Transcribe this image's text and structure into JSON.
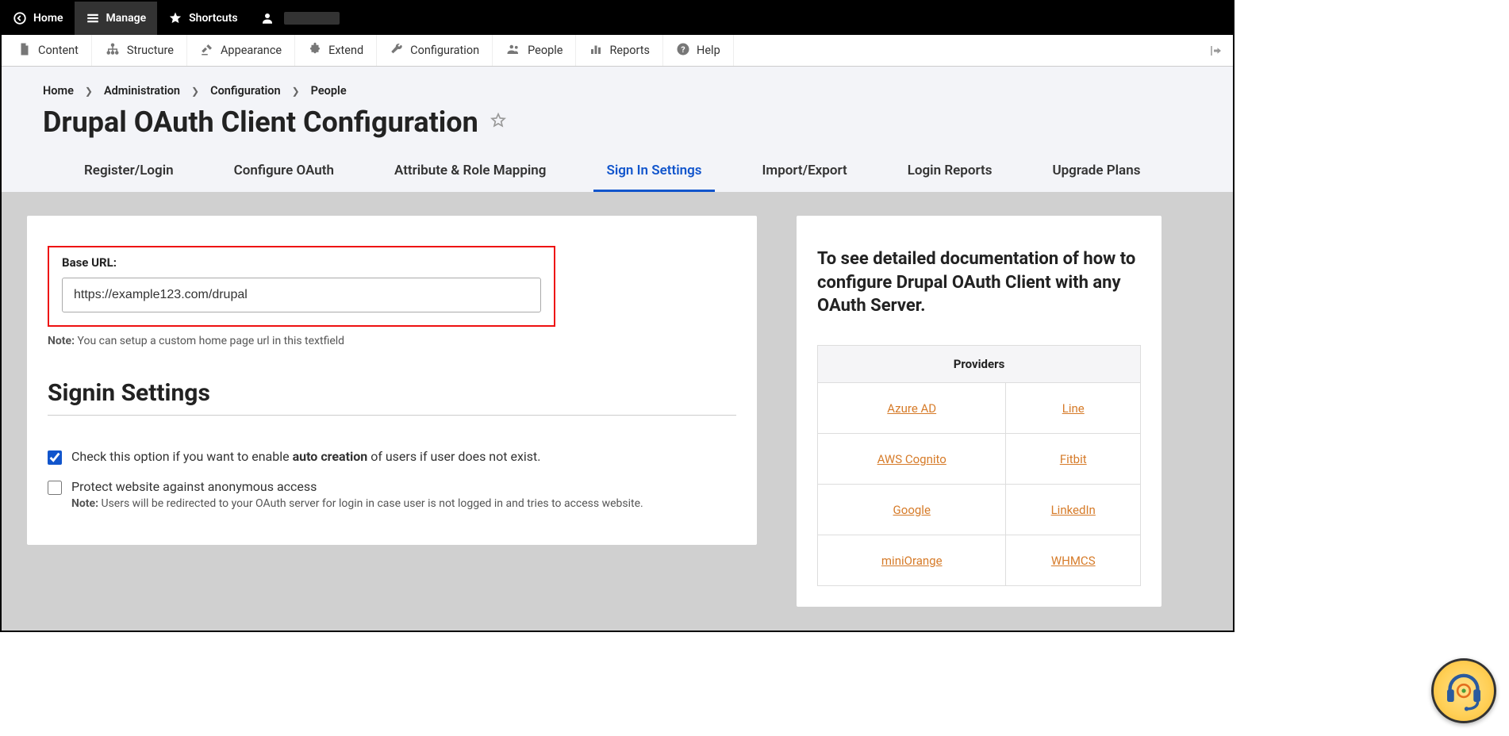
{
  "top_toolbar": {
    "home": "Home",
    "manage": "Manage",
    "shortcuts": "Shortcuts"
  },
  "admin_menu": {
    "content": "Content",
    "structure": "Structure",
    "appearance": "Appearance",
    "extend": "Extend",
    "configuration": "Configuration",
    "people": "People",
    "reports": "Reports",
    "help": "Help"
  },
  "breadcrumb": {
    "home": "Home",
    "administration": "Administration",
    "configuration": "Configuration",
    "people": "People"
  },
  "page_title": "Drupal OAuth Client Configuration",
  "tabs": {
    "register": "Register/Login",
    "configure": "Configure OAuth",
    "attribute": "Attribute & Role Mapping",
    "signin": "Sign In Settings",
    "import": "Import/Export",
    "login_reports": "Login Reports",
    "upgrade": "Upgrade Plans"
  },
  "base_url": {
    "label": "Base URL:",
    "value": "https://example123.com/drupal",
    "note_label": "Note:",
    "note_text": " You can setup a custom home page url in this textfield"
  },
  "signin": {
    "title": "Signin Settings",
    "auto_create_pre": "Check this option if you want to enable ",
    "auto_create_bold": "auto creation",
    "auto_create_post": " of users if user does not exist.",
    "protect_label": "Protect website against anonymous access",
    "protect_note_label": "Note:",
    "protect_note_text": " Users will be redirected to your OAuth server for login in case user is not logged in and tries to access website."
  },
  "right": {
    "heading": "To see detailed documentation of how to configure Drupal OAuth Client with any OAuth Server.",
    "providers_header": "Providers",
    "providers": [
      [
        "Azure AD",
        "Line"
      ],
      [
        "AWS Cognito",
        "Fitbit"
      ],
      [
        "Google",
        "LinkedIn"
      ],
      [
        "miniOrange",
        "WHMCS"
      ]
    ]
  }
}
